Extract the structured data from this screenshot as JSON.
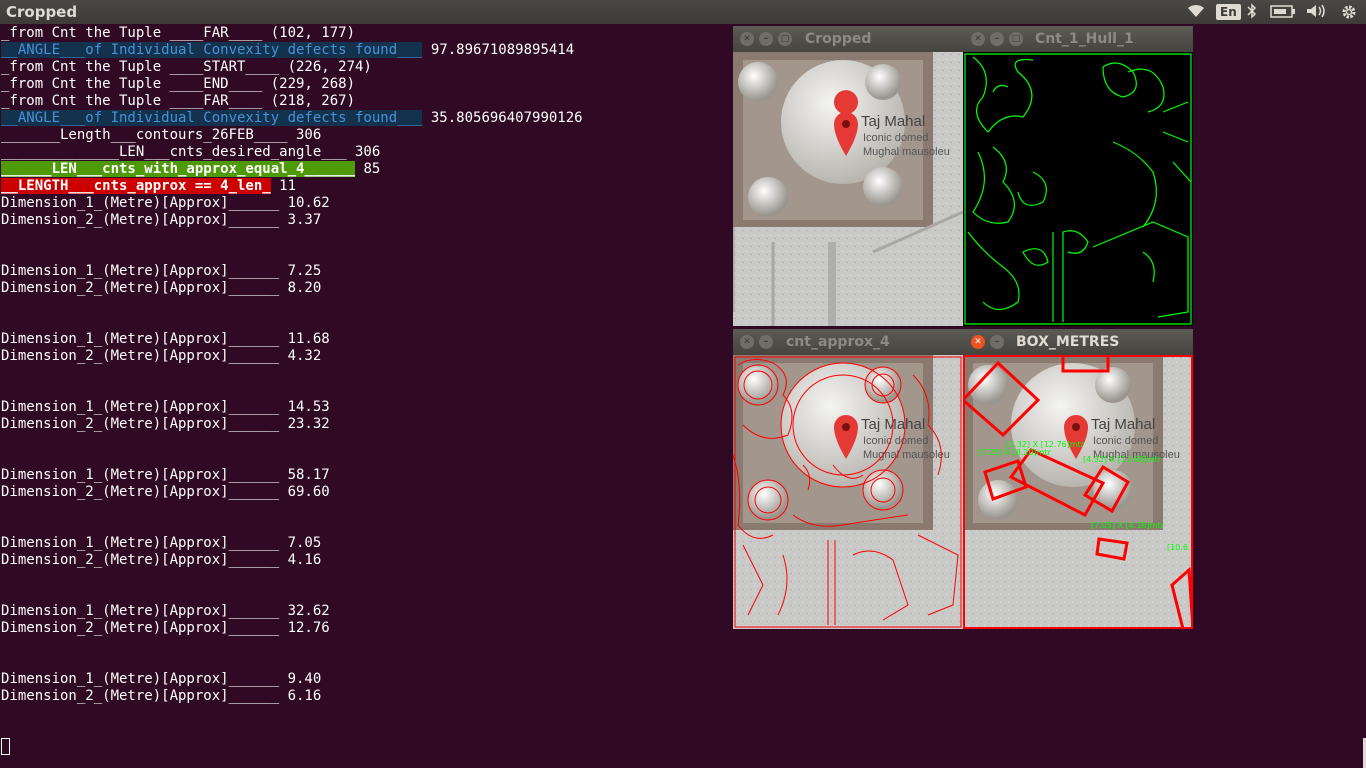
{
  "topbar": {
    "title": "Cropped",
    "lang": "En",
    "icons": [
      "wifi-icon",
      "keyboard-lang-icon",
      "bluetooth-icon",
      "battery-icon",
      "volume-icon",
      "settings-gear-icon"
    ]
  },
  "terminal": {
    "lines": [
      "_from Cnt the Tuple ____FAR____ (102, 177)",
      "__ANGLE___of Individual Convexity defects found___ 97.89671089895414",
      "_from Cnt the Tuple ____START____ (226, 274)",
      "_from Cnt the Tuple ____END____ (229, 268)",
      "_from Cnt the Tuple ____FAR____ (218, 267)",
      "__ANGLE___of Individual Convexity defects found___ 35.805696407990126",
      "_______Length___contours_26FEB____ 306",
      "______________LEN___cnts_desired_angle___ 306",
      "______LEN___cnts_with_approx_equal_4______ 85",
      "__LENGTH___cnts_approx == 4_len_ 11",
      "Dimension_1_(Metre)[Approx]______ 10.62",
      "Dimension_2_(Metre)[Approx]______ 3.37",
      "",
      "",
      "Dimension_1_(Metre)[Approx]______ 7.25",
      "Dimension_2_(Metre)[Approx]______ 8.20",
      "",
      "",
      "Dimension_1_(Metre)[Approx]______ 11.68",
      "Dimension_2_(Metre)[Approx]______ 4.32",
      "",
      "",
      "Dimension_1_(Metre)[Approx]______ 14.53",
      "Dimension_2_(Metre)[Approx]______ 23.32",
      "",
      "",
      "Dimension_1_(Metre)[Approx]______ 58.17",
      "Dimension_2_(Metre)[Approx]______ 69.60",
      "",
      "",
      "Dimension_1_(Metre)[Approx]______ 7.05",
      "Dimension_2_(Metre)[Approx]______ 4.16",
      "",
      "",
      "Dimension_1_(Metre)[Approx]______ 32.62",
      "Dimension_2_(Metre)[Approx]______ 12.76",
      "",
      "",
      "Dimension_1_(Metre)[Approx]______ 9.40",
      "Dimension_2_(Metre)[Approx]______ 6.16"
    ],
    "hl": {
      "blue_1": "__ANGLE___of Individual Convexity defects found___",
      "blue_1_rest": " 97.89671089895414",
      "blue_2": "__ANGLE___of Individual Convexity defects found___",
      "blue_2_rest": " 35.805696407990126",
      "green": "______LEN___cnts_with_approx_equal_4______",
      "green_rest": " 85",
      "red": "__LENGTH___cnts_approx == 4_len_",
      "red_rest": " 11"
    }
  },
  "windows": {
    "cropped": {
      "title": "Cropped"
    },
    "hull": {
      "title": "Cnt_1_Hull_1"
    },
    "approx": {
      "title": "cnt_approx_4"
    },
    "box": {
      "title": "BOX_METRES"
    }
  },
  "map_labels": {
    "name": "Taj Mahal",
    "sub1": "Iconic domed",
    "sub2": "Mughal mausoleu"
  },
  "box_labels": [
    "[3.32] X [12.76]mtr",
    "[7.25] X [8.20]mtr",
    "[4.32] X [11.68]mtr",
    "[7.05] X [4.16]mtr",
    "[10.6"
  ],
  "colors": {
    "terminal_bg": "#300a24",
    "contour_green": "#00ff00",
    "contour_red": "#ff0000",
    "close_orange": "#e95420"
  }
}
